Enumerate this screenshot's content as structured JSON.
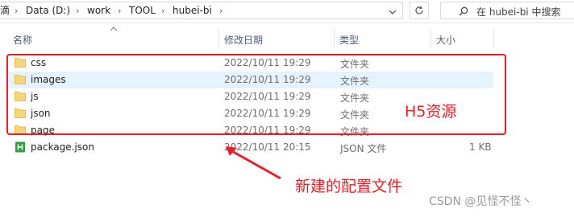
{
  "address_bar": {
    "crumbs": [
      "滴",
      "Data (D:)",
      "work",
      "TOOL",
      "hubei-bi"
    ]
  },
  "search": {
    "placeholder": "在 hubei-bi 中搜索"
  },
  "columns": {
    "name": "名称",
    "date": "修改日期",
    "type": "类型",
    "size": "大小"
  },
  "files": [
    {
      "name": "css",
      "date": "2022/10/11 19:29",
      "type": "文件夹",
      "size": "",
      "icon": "folder-icon"
    },
    {
      "name": "images",
      "date": "2022/10/11 19:29",
      "type": "文件夹",
      "size": "",
      "icon": "folder-icon"
    },
    {
      "name": "js",
      "date": "2022/10/11 19:29",
      "type": "文件夹",
      "size": "",
      "icon": "folder-icon"
    },
    {
      "name": "json",
      "date": "2022/10/11 19:29",
      "type": "文件夹",
      "size": "",
      "icon": "folder-icon"
    },
    {
      "name": "page",
      "date": "2022/10/11 19:29",
      "type": "文件夹",
      "size": "",
      "icon": "folder-icon"
    },
    {
      "name": "package.json",
      "date": "2022/10/11 20:15",
      "type": "JSON 文件",
      "size": "1 KB",
      "icon": "json-file-icon"
    }
  ],
  "selected_row": "images",
  "annotations": {
    "h5_label": "H5资源",
    "config_label": "新建的配置文件",
    "color": "#ee1c25"
  },
  "watermark": "CSDN @见怪不怪丶"
}
